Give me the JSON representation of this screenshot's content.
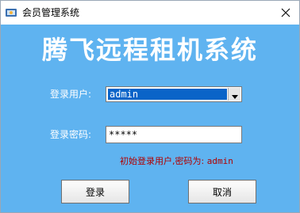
{
  "window": {
    "title": "会员管理系统",
    "close_symbol": "✕"
  },
  "banner": {
    "text": "腾飞远程租机系统"
  },
  "form": {
    "user_label": "登录用户:",
    "user_value": "admin",
    "password_label": "登录密码:",
    "password_value": "*****",
    "hint_prefix": "初始登录用户,密码为:",
    "hint_user": "admin"
  },
  "buttons": {
    "login_label": "登录",
    "cancel_label": "取消"
  },
  "icons": {
    "app": "app-icon",
    "close": "close-icon",
    "dropdown": "chevron-down-icon"
  },
  "colors": {
    "client_background": "#5fb3f0",
    "selection": "#0a64c8",
    "hint": "#b00000",
    "banner_text": "#ffffff"
  }
}
